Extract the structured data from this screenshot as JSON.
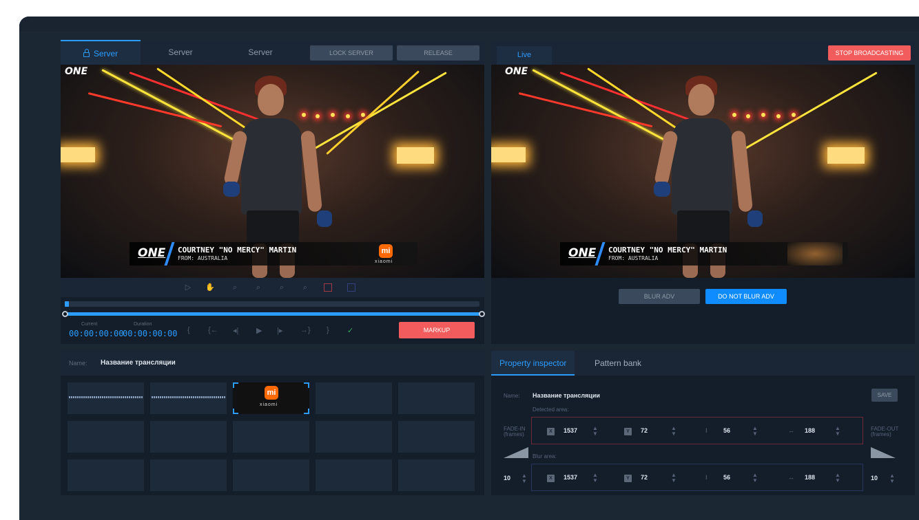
{
  "server_panel": {
    "tabs": [
      "Server",
      "Server",
      "Server"
    ],
    "lock_server_label": "LOCK SERVER",
    "release_label": "RELEASE"
  },
  "video": {
    "logo": "ONE",
    "lower_third_logo": "ONE",
    "fighter_name": "COURTNEY \"NO MERCY\" MARTIN",
    "fighter_from": "FROM: AUSTRALIA",
    "sponsor_mark": "mi",
    "sponsor_text": "xiaomi"
  },
  "timeline": {
    "current_label": "Current",
    "current_value": "00:00:00:00",
    "duration_label": "Duration",
    "duration_value": "00:00:00:00",
    "markup_label": "MARKUP"
  },
  "live_panel": {
    "live_label": "Live",
    "stop_label": "STOP BROADCASTING",
    "blur_label": "BLUR ADV",
    "no_blur_label": "DO NOT BLUR ADV"
  },
  "clips": {
    "name_label": "Name:",
    "name_value": "Название трансляции",
    "selected_mark": "mi",
    "selected_text": "xiaomi"
  },
  "inspector": {
    "tab_property": "Property inspector",
    "tab_pattern": "Pattern bank",
    "name_label": "Name:",
    "name_value": "Название трансляции",
    "save_label": "SAVE",
    "detected_label": "Detected area:",
    "blur_label": "Blur area:",
    "fade_in_label": "FADE-IN",
    "fade_in_unit": "(frames)",
    "fade_out_label": "FADE-OUT",
    "fade_out_unit": "(frames)",
    "fade_in_value": "10",
    "fade_out_value": "10",
    "detected": {
      "x": "1537",
      "y": "72",
      "h": "56",
      "w": "188"
    },
    "blur": {
      "x": "1537",
      "y": "72",
      "h": "56",
      "w": "188"
    }
  },
  "colors": {
    "accent": "#2d9cff",
    "danger": "#f25c5c",
    "background": "#1c2734"
  }
}
